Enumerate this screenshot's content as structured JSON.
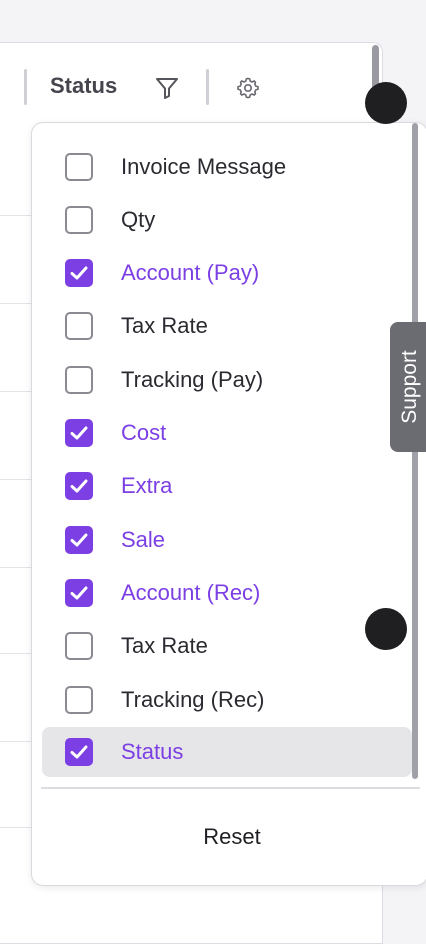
{
  "table": {
    "status_header": "Status"
  },
  "column_menu": {
    "items": [
      {
        "label": "Invoice Message",
        "checked": false
      },
      {
        "label": "Qty",
        "checked": false
      },
      {
        "label": "Account (Pay)",
        "checked": true
      },
      {
        "label": "Tax Rate",
        "checked": false
      },
      {
        "label": "Tracking (Pay)",
        "checked": false
      },
      {
        "label": "Cost",
        "checked": true
      },
      {
        "label": "Extra",
        "checked": true
      },
      {
        "label": "Sale",
        "checked": true
      },
      {
        "label": "Account (Rec)",
        "checked": true
      },
      {
        "label": "Tax Rate",
        "checked": false
      },
      {
        "label": "Tracking (Rec)",
        "checked": false
      },
      {
        "label": "Status",
        "checked": true,
        "highlighted": true
      }
    ],
    "reset_label": "Reset"
  },
  "support": {
    "label": "Support"
  },
  "colors": {
    "accent": "#7b3fe4",
    "support_tab": "#6b6b72"
  },
  "icons": {
    "filter": "filter-icon",
    "settings": "gear-icon",
    "check": "check-icon"
  }
}
